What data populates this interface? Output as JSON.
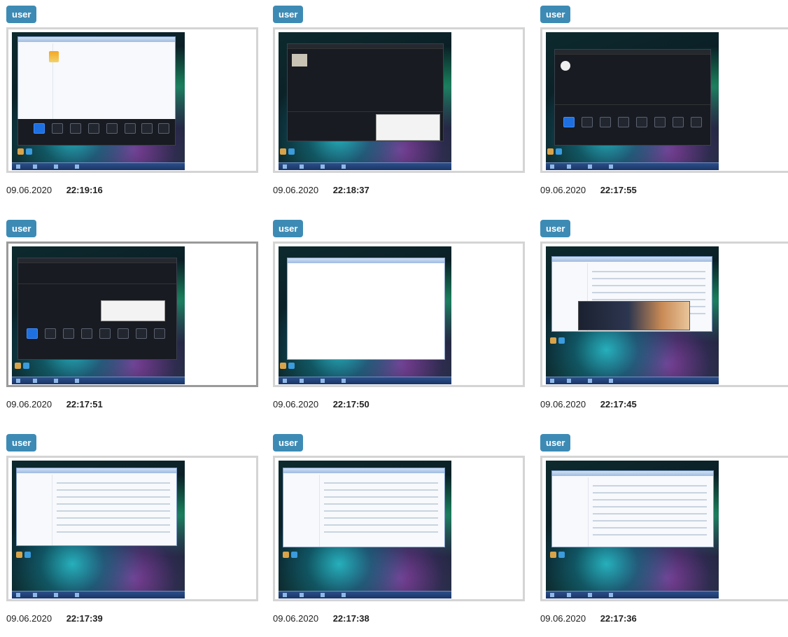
{
  "screenshots": [
    {
      "user": "user",
      "date": "09.06.2020",
      "time": "22:19:16"
    },
    {
      "user": "user",
      "date": "09.06.2020",
      "time": "22:18:37"
    },
    {
      "user": "user",
      "date": "09.06.2020",
      "time": "22:17:55"
    },
    {
      "user": "user",
      "date": "09.06.2020",
      "time": "22:17:51"
    },
    {
      "user": "user",
      "date": "09.06.2020",
      "time": "22:17:50"
    },
    {
      "user": "user",
      "date": "09.06.2020",
      "time": "22:17:45"
    },
    {
      "user": "user",
      "date": "09.06.2020",
      "time": "22:17:39"
    },
    {
      "user": "user",
      "date": "09.06.2020",
      "time": "22:17:38"
    },
    {
      "user": "user",
      "date": "09.06.2020",
      "time": "22:17:36"
    }
  ],
  "colors": {
    "badge": "#3d8bb5",
    "frame_border": "#d4d4d4",
    "frame_border_selected": "#9a9a9a"
  }
}
